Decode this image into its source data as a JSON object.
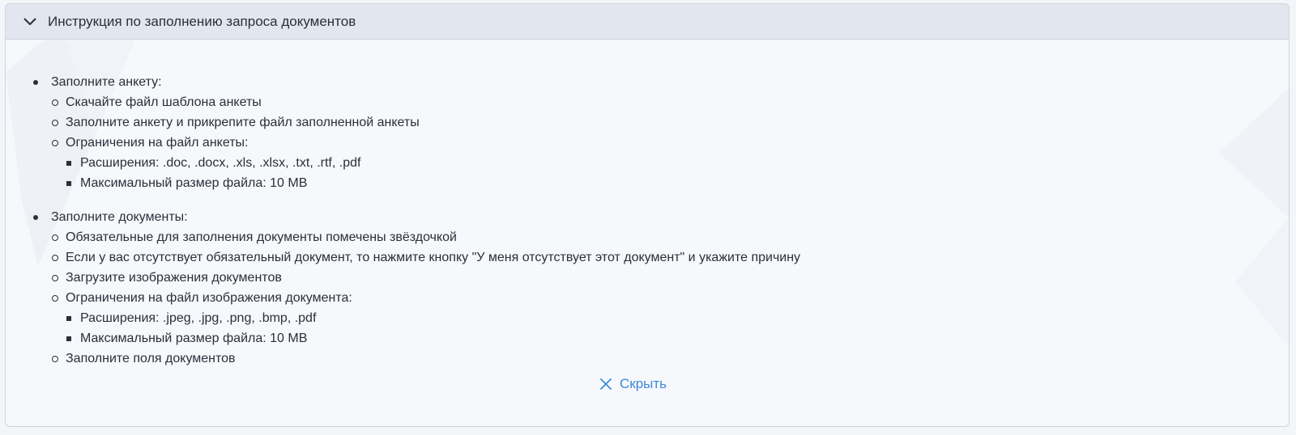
{
  "panel": {
    "title": "Инструкция по заполнению запроса документов",
    "expanded": true,
    "icon": "chevron-down-icon",
    "hide_icon": "close-icon",
    "hide_label": "Скрыть",
    "accent_color": "#3f8bd8"
  },
  "sections": [
    {
      "label": "Заполните анкету:",
      "items": [
        {
          "label": "Скачайте файл шаблона анкеты",
          "subitems": []
        },
        {
          "label": "Заполните анкету и прикрепите файл заполненной анкеты",
          "subitems": []
        },
        {
          "label": "Ограничения на файл анкеты:",
          "subitems": [
            "Расширения: .doc, .docx, .xls, .xlsx, .txt, .rtf, .pdf",
            "Максимальный размер файла: 10 MB"
          ]
        }
      ]
    },
    {
      "label": "Заполните документы:",
      "items": [
        {
          "label": "Обязательные для заполнения документы помечены звёздочкой",
          "subitems": []
        },
        {
          "label": "Если у вас отсутствует обязательный документ, то нажмите кнопку \"У меня отсутствует этот документ\" и укажите причину",
          "subitems": []
        },
        {
          "label": "Загрузите изображения документов",
          "subitems": []
        },
        {
          "label": "Ограничения на файл изображения документа:",
          "subitems": [
            "Расширения: .jpeg, .jpg, .png, .bmp, .pdf",
            "Максимальный размер файла: 10 MB"
          ]
        },
        {
          "label": "Заполните поля документов",
          "subitems": []
        }
      ]
    }
  ]
}
